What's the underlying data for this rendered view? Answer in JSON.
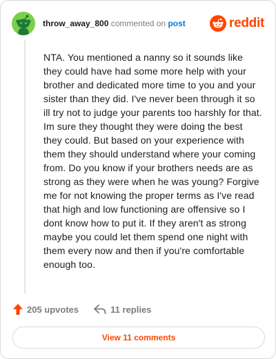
{
  "header": {
    "username": "throw_away_800",
    "action_text": "commented on",
    "post_link": "post",
    "brand": "reddit"
  },
  "comment": {
    "body": "NTA. You mentioned a nanny so it sounds like they could have had some more help with your brother and dedicated more time to you and your sister than they did. I've never been through it so ill try not to judge your parents too harshly for that. Im sure they thought they were doing the best they could. But based on your experience with them they should understand where your coming from. Do you know if your brothers needs are as strong as they were when he was young? Forgive me for not knowing the proper terms as I've read that high and low functioning are offensive so I dont know how to put it. If they aren't as strong maybe you could let them spend one night with them every now and then if you're comfortable enough too."
  },
  "stats": {
    "upvotes": "205 upvotes",
    "replies": "11 replies"
  },
  "footer": {
    "view_comments": "View 11 comments"
  },
  "icons": {
    "avatar": "snoo-avatar-icon",
    "brand": "reddit-logo-icon",
    "upvote": "upvote-arrow-icon",
    "reply": "reply-arrow-icon"
  },
  "colors": {
    "accent": "#ff4500",
    "link": "#0079d3",
    "avatar_bg": "#7bd04a",
    "muted": "#7c7c7c"
  }
}
